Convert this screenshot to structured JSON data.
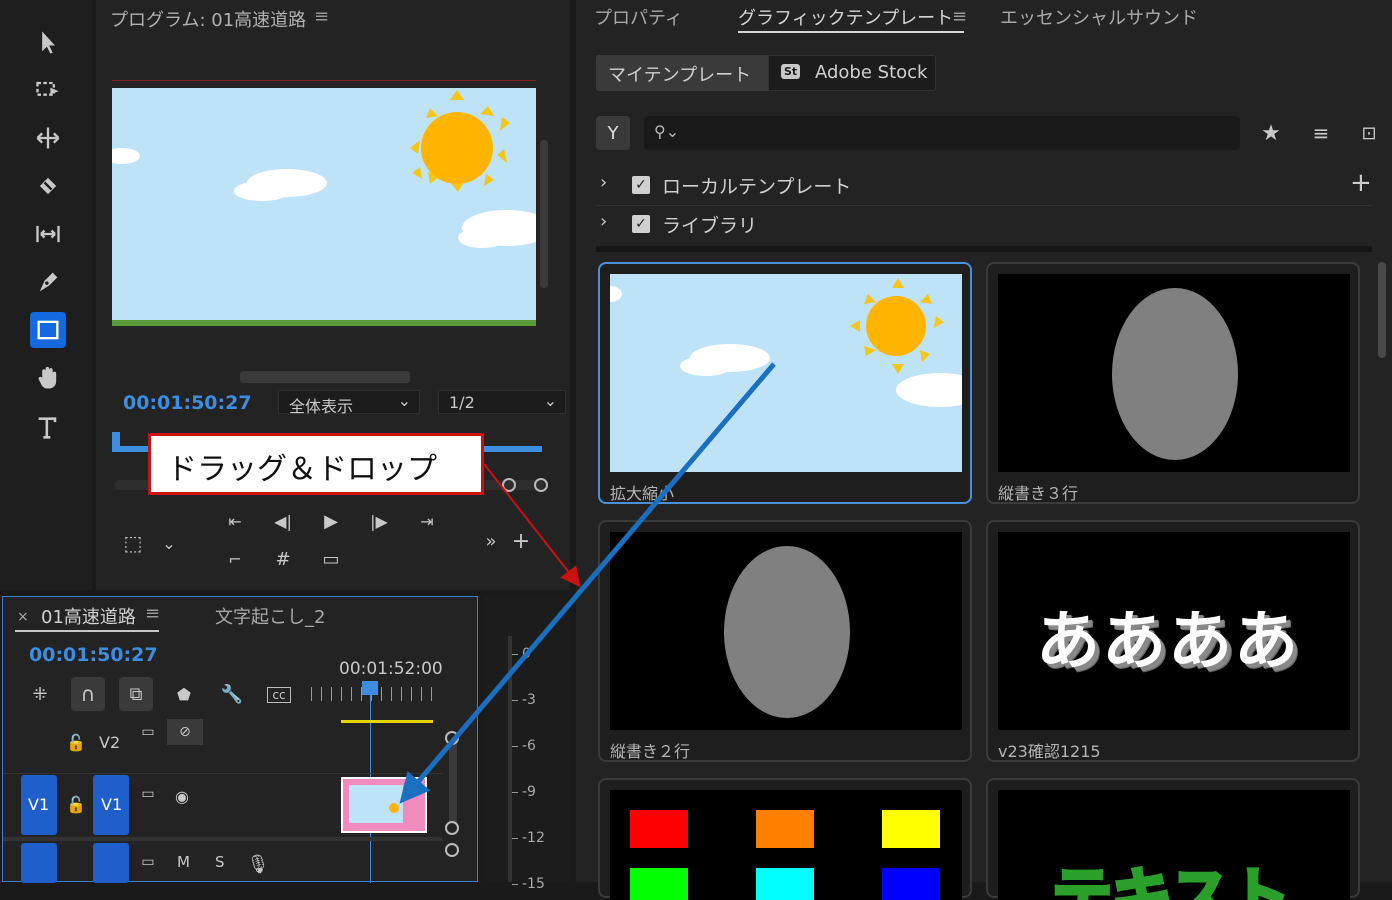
{
  "program": {
    "title": "プログラム: 01高速道路",
    "timecode": "00:01:50:27",
    "fit": "全体表示",
    "resolution": "1/2"
  },
  "callout": "ドラッグ＆ドロップ",
  "timeline": {
    "tab_active": "01高速道路",
    "tab_other": "文字起こし_2",
    "close": "×",
    "timecode": "00:01:50:27",
    "ruler_time": "00:01:52:00",
    "tracks": {
      "v2": "V2",
      "v1_src": "V1",
      "v1": "V1",
      "m": "M",
      "s": "S"
    }
  },
  "meter_ticks": [
    "0",
    "-3",
    "-6",
    "-9",
    "-12",
    "-15"
  ],
  "right_panel": {
    "tabs": [
      "プロパティ",
      "グラフィックテンプレート",
      "エッセンシャルサウンド"
    ],
    "subtabs": {
      "my": "マイテンプレート",
      "stock": "Adobe Stock",
      "stock_badge": "St"
    },
    "tree": [
      {
        "label": "ローカルテンプレート"
      },
      {
        "label": "ライブラリ"
      }
    ],
    "plus": "+",
    "cards": [
      {
        "label": "拡大縮小"
      },
      {
        "label": "縦書き３行"
      },
      {
        "label": "縦書き２行"
      },
      {
        "label": "v23確認1215"
      },
      {
        "label": ""
      },
      {
        "label": ""
      }
    ],
    "card4_text": "ああああ",
    "card6_text": "テキスト",
    "swatches": [
      "#ff0000",
      "#ff8000",
      "#ffff00",
      "#00ff00",
      "#00ffff",
      "#0000ff"
    ]
  },
  "colors": {
    "accent_blue": "#4a90d9",
    "timecode_blue": "#3d8de0",
    "track_blue": "#1f5fcc",
    "callout_red": "#cc1111",
    "arrow_blue": "#1a6fc0"
  }
}
